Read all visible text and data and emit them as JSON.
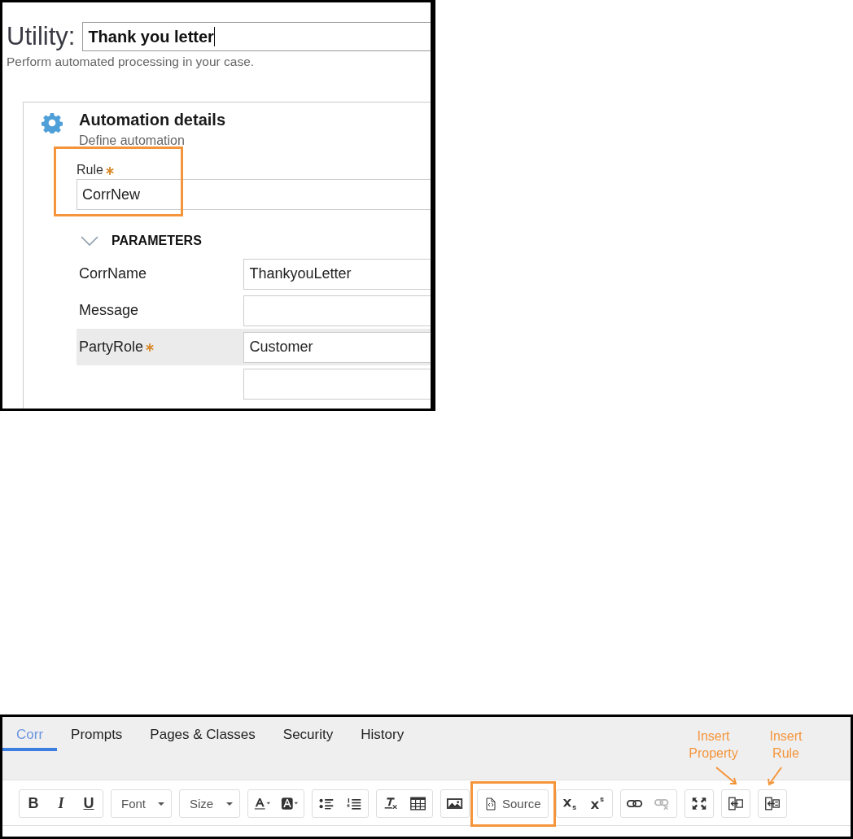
{
  "utility": {
    "label": "Utility:",
    "value": "Thank you letter",
    "description": "Perform automated processing in your case."
  },
  "automation": {
    "title": "Automation details",
    "subtitle": "Define automation",
    "rule": {
      "label": "Rule",
      "required": true,
      "value": "CorrNew",
      "highlighted": true
    },
    "parameters": {
      "heading": "PARAMETERS",
      "expanded": true,
      "rows": [
        {
          "name": "CorrName",
          "value": "ThankyouLetter",
          "required": false,
          "selected": false
        },
        {
          "name": "Message",
          "required": false,
          "selected": false
        },
        {
          "name": "PartyRole",
          "value": "Customer",
          "required": true,
          "selected": true
        },
        {
          "required": false,
          "selected": false
        }
      ]
    }
  },
  "tabs": [
    {
      "label": "Corr",
      "selected": true
    },
    {
      "label": "Prompts",
      "selected": false
    },
    {
      "label": "Pages & Classes",
      "selected": false
    },
    {
      "label": "Security",
      "selected": false
    },
    {
      "label": "History",
      "selected": false
    }
  ],
  "toolbar": [
    [
      {
        "kind": "bold",
        "label": "B"
      },
      {
        "kind": "italic",
        "label": "I"
      },
      {
        "kind": "underline",
        "label": "U"
      }
    ],
    [
      {
        "kind": "dropdown",
        "label": "Font"
      }
    ],
    [
      {
        "kind": "dropdown",
        "label": "Size"
      }
    ],
    [
      {
        "kind": "textcolor"
      },
      {
        "kind": "bgcolor"
      }
    ],
    [
      {
        "kind": "bullets"
      },
      {
        "kind": "numbers"
      }
    ],
    [
      {
        "kind": "clearformat"
      },
      {
        "kind": "table"
      }
    ],
    [
      {
        "kind": "image"
      }
    ],
    [
      {
        "kind": "source",
        "label": "Source",
        "highlighted": true
      }
    ],
    [
      {
        "kind": "subscript"
      },
      {
        "kind": "superscript"
      }
    ],
    [
      {
        "kind": "link"
      },
      {
        "kind": "unlink",
        "disabled": true
      }
    ],
    [
      {
        "kind": "maximize"
      }
    ],
    [
      {
        "kind": "insertproperty",
        "annotation": "Insert Property"
      }
    ],
    [
      {
        "kind": "insertrule",
        "annotation": "Insert Rule"
      }
    ]
  ]
}
